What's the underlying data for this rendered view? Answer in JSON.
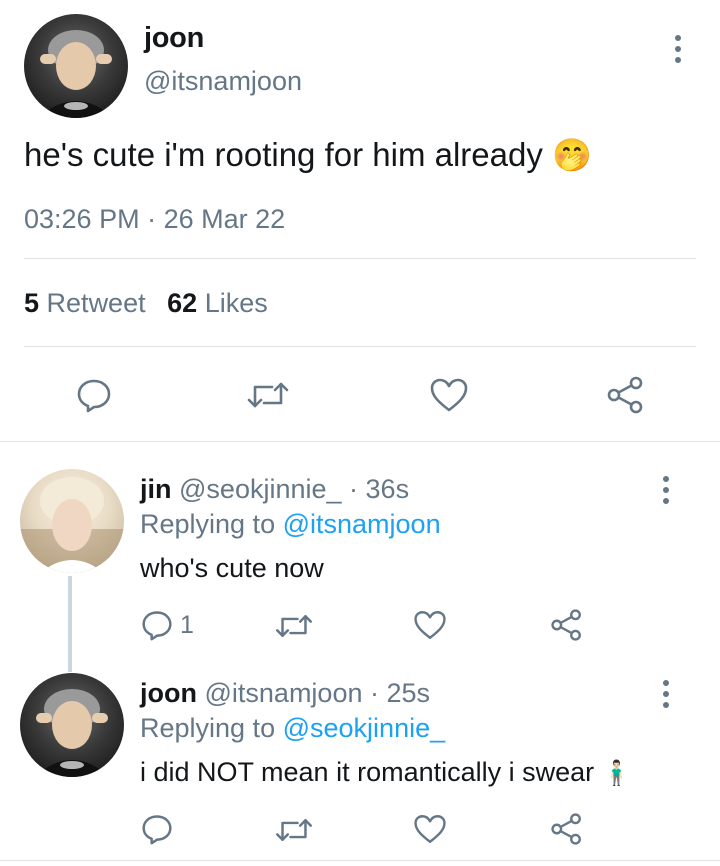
{
  "main_tweet": {
    "display_name": "joon",
    "handle": "@itsnamjoon",
    "text": "he's cute i'm rooting for him already",
    "emoji": "🤭",
    "time": "03:26 PM",
    "sep": "·",
    "date": "26 Mar 22",
    "retweet_count": "5",
    "retweet_label": "Retweet",
    "likes_count": "62",
    "likes_label": "Likes"
  },
  "replies": [
    {
      "display_name": "jin",
      "handle": "@seokjinnie_",
      "age": "· 36s",
      "replying_prefix": "Replying to",
      "replying_to": "@itsnamjoon",
      "text": "who's cute now",
      "reply_count": "1"
    },
    {
      "display_name": "joon",
      "handle": "@itsnamjoon",
      "age": "· 25s",
      "replying_prefix": "Replying to",
      "replying_to": "@seokjinnie_",
      "text": "i did NOT mean it romantically i swear",
      "emoji": "🧍🏻‍♂️"
    }
  ],
  "icons": {
    "reply": "speech-bubble-icon",
    "retweet": "retweet-arrows-icon",
    "like": "heart-outline-icon",
    "share": "share-nodes-icon",
    "more": "vertical-dots-icon"
  },
  "colors": {
    "text": "#14171a",
    "muted": "#657786",
    "link": "#1da1f2",
    "divider": "#dfe3e6"
  }
}
